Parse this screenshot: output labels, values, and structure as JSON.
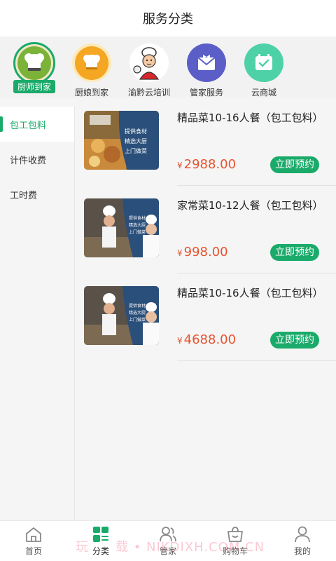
{
  "header": {
    "title": "服务分类"
  },
  "categories": [
    {
      "label": "厨师到家",
      "icon": "chef-hat-icon",
      "active": true
    },
    {
      "label": "厨娘到家",
      "icon": "chef-cap-icon",
      "active": false
    },
    {
      "label": "渝黔云培训",
      "icon": "chef-character-icon",
      "active": false
    },
    {
      "label": "管家服务",
      "icon": "butler-icon",
      "active": false
    },
    {
      "label": "云商城",
      "icon": "calendar-icon",
      "active": false
    }
  ],
  "sidebar": {
    "items": [
      {
        "label": "包工包料"
      },
      {
        "label": "计件收费"
      },
      {
        "label": "工时费"
      }
    ]
  },
  "products": [
    {
      "title": "精品菜10-16人餐（包工包料）",
      "currency": "¥",
      "price": "2988.00",
      "button": "立即预约"
    },
    {
      "title": "家常菜10-12人餐（包工包料）",
      "currency": "¥",
      "price": "998.00",
      "button": "立即预约"
    },
    {
      "title": "精品菜10-16人餐（包工包料）",
      "currency": "¥",
      "price": "4688.00",
      "button": "立即预约"
    }
  ],
  "tabbar": {
    "items": [
      {
        "label": "首页",
        "icon": "home-icon"
      },
      {
        "label": "分类",
        "icon": "category-icon"
      },
      {
        "label": "管家",
        "icon": "users-icon"
      },
      {
        "label": "购物车",
        "icon": "cart-icon"
      },
      {
        "label": "我的",
        "icon": "user-icon"
      }
    ]
  },
  "watermark": "玩　　载 • NIKDIXH.COM.CN",
  "colors": {
    "accent": "#1aaa6a",
    "price": "#e8532f"
  }
}
